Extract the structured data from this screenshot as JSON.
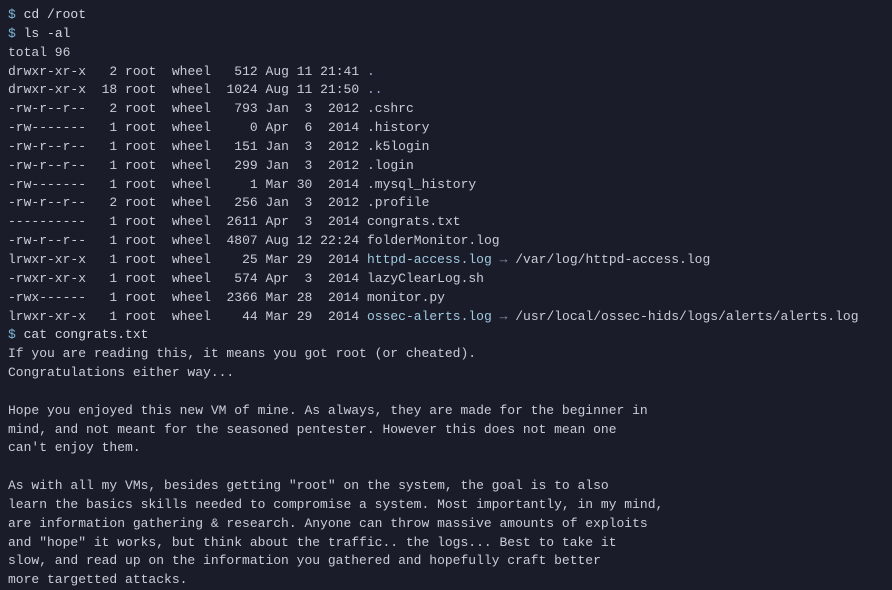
{
  "prompt_symbol": "$",
  "commands": {
    "cd": "cd /root",
    "ls": "ls -al",
    "cat": "cat congrats.txt"
  },
  "ls_total": "total 96",
  "files": [
    {
      "perms": "drwxr-xr-x",
      "links": "2",
      "owner": "root",
      "group": "wheel",
      "size": "512",
      "date": "Aug 11 21:41",
      "name": ".",
      "type": "dir"
    },
    {
      "perms": "drwxr-xr-x",
      "links": "18",
      "owner": "root",
      "group": "wheel",
      "size": "1024",
      "date": "Aug 11 21:50",
      "name": "..",
      "type": "dir"
    },
    {
      "perms": "-rw-r--r--",
      "links": "2",
      "owner": "root",
      "group": "wheel",
      "size": "793",
      "date": "Jan  3  2012",
      "name": ".cshrc",
      "type": "file"
    },
    {
      "perms": "-rw-------",
      "links": "1",
      "owner": "root",
      "group": "wheel",
      "size": "0",
      "date": "Apr  6  2014",
      "name": ".history",
      "type": "file"
    },
    {
      "perms": "-rw-r--r--",
      "links": "1",
      "owner": "root",
      "group": "wheel",
      "size": "151",
      "date": "Jan  3  2012",
      "name": ".k5login",
      "type": "file"
    },
    {
      "perms": "-rw-r--r--",
      "links": "1",
      "owner": "root",
      "group": "wheel",
      "size": "299",
      "date": "Jan  3  2012",
      "name": ".login",
      "type": "file"
    },
    {
      "perms": "-rw-------",
      "links": "1",
      "owner": "root",
      "group": "wheel",
      "size": "1",
      "date": "Mar 30  2014",
      "name": ".mysql_history",
      "type": "file"
    },
    {
      "perms": "-rw-r--r--",
      "links": "2",
      "owner": "root",
      "group": "wheel",
      "size": "256",
      "date": "Jan  3  2012",
      "name": ".profile",
      "type": "file"
    },
    {
      "perms": "----------",
      "links": "1",
      "owner": "root",
      "group": "wheel",
      "size": "2611",
      "date": "Apr  3  2014",
      "name": "congrats.txt",
      "type": "file"
    },
    {
      "perms": "-rw-r--r--",
      "links": "1",
      "owner": "root",
      "group": "wheel",
      "size": "4807",
      "date": "Aug 12 22:24",
      "name": "folderMonitor.log",
      "type": "file"
    },
    {
      "perms": "lrwxr-xr-x",
      "links": "1",
      "owner": "root",
      "group": "wheel",
      "size": "25",
      "date": "Mar 29  2014",
      "name": "httpd-access.log",
      "type": "link",
      "target": "/var/log/httpd-access.log"
    },
    {
      "perms": "-rwxr-xr-x",
      "links": "1",
      "owner": "root",
      "group": "wheel",
      "size": "574",
      "date": "Apr  3  2014",
      "name": "lazyClearLog.sh",
      "type": "file"
    },
    {
      "perms": "-rwx------",
      "links": "1",
      "owner": "root",
      "group": "wheel",
      "size": "2366",
      "date": "Mar 28  2014",
      "name": "monitor.py",
      "type": "file"
    },
    {
      "perms": "lrwxr-xr-x",
      "links": "1",
      "owner": "root",
      "group": "wheel",
      "size": "44",
      "date": "Mar 29  2014",
      "name": "ossec-alerts.log",
      "type": "link",
      "target": "/usr/local/ossec-hids/logs/alerts/alerts.log"
    }
  ],
  "arrow_glyph": "→",
  "congrats_lines": [
    "If you are reading this, it means you got root (or cheated).",
    "Congratulations either way...",
    "",
    "Hope you enjoyed this new VM of mine. As always, they are made for the beginner in",
    "mind, and not meant for the seasoned pentester. However this does not mean one",
    "can't enjoy them.",
    "",
    "As with all my VMs, besides getting \"root\" on the system, the goal is to also",
    "learn the basics skills needed to compromise a system. Most importantly, in my mind,",
    "are information gathering & research. Anyone can throw massive amounts of exploits",
    "and \"hope\" it works, but think about the traffic.. the logs... Best to take it",
    "slow, and read up on the information you gathered and hopefully craft better",
    "more targetted attacks."
  ]
}
